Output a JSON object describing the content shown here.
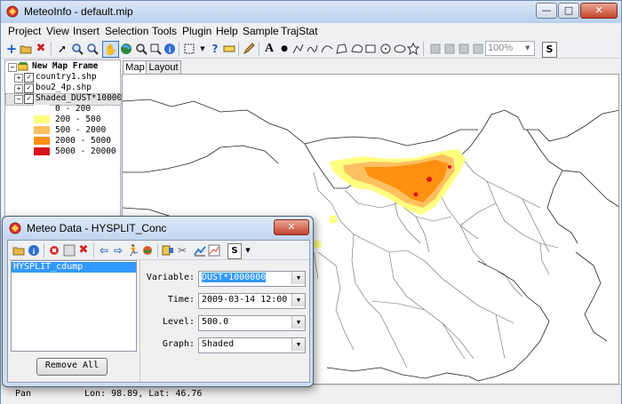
{
  "window": {
    "title": "MeteoInfo - default.mip",
    "controls": {
      "minimize": "—",
      "maximize": "□",
      "close": "✕"
    }
  },
  "menubar": [
    "Project",
    "View",
    "Insert",
    "Selection",
    "Tools",
    "Plugin",
    "Help",
    "Sample",
    "TrajStat"
  ],
  "toolbar": {
    "zoom_value": "100%"
  },
  "legend": {
    "frame_name": "New Map Frame",
    "layers": [
      "country1.shp",
      "bou2_4p.shp",
      "Shaded_DUST*1000000"
    ],
    "classes": [
      {
        "label": "0 - 200",
        "color": "#ffffff"
      },
      {
        "label": "200 - 500",
        "color": "#ffff80"
      },
      {
        "label": "500 - 2000",
        "color": "#ffc060"
      },
      {
        "label": "2000 - 5000",
        "color": "#ff9010"
      },
      {
        "label": "5000 - 20000",
        "color": "#d8141c"
      }
    ]
  },
  "tabs": {
    "map": "Map",
    "layout": "Layout"
  },
  "statusbar": {
    "mode": "Pan",
    "coords": "Lon: 98.89, Lat: 46.76"
  },
  "dialog": {
    "title": "Meteo Data - HYSPLIT_Conc",
    "close": "✕",
    "datasets": [
      "HYSPLIT_cdump"
    ],
    "remove_all": "Remove All",
    "fields": {
      "variable_label": "Variable:",
      "variable_value": "DUST*1000000",
      "time_label": "Time:",
      "time_value": "2009-03-14 12:00",
      "level_label": "Level:",
      "level_value": "500.0",
      "graph_label": "Graph:",
      "graph_value": "Shaded"
    }
  },
  "icons": {
    "add_layer": "add-layer-icon",
    "open": "open-folder-icon",
    "remove": "remove-icon",
    "select": "select-arrow-icon",
    "zoom_in": "zoom-in-icon",
    "zoom_out": "zoom-out-icon",
    "pan": "pan-hand-icon",
    "full_extent": "globe-icon",
    "info": "info-icon",
    "text": "text-tool-icon",
    "point": "point-tool-icon"
  }
}
